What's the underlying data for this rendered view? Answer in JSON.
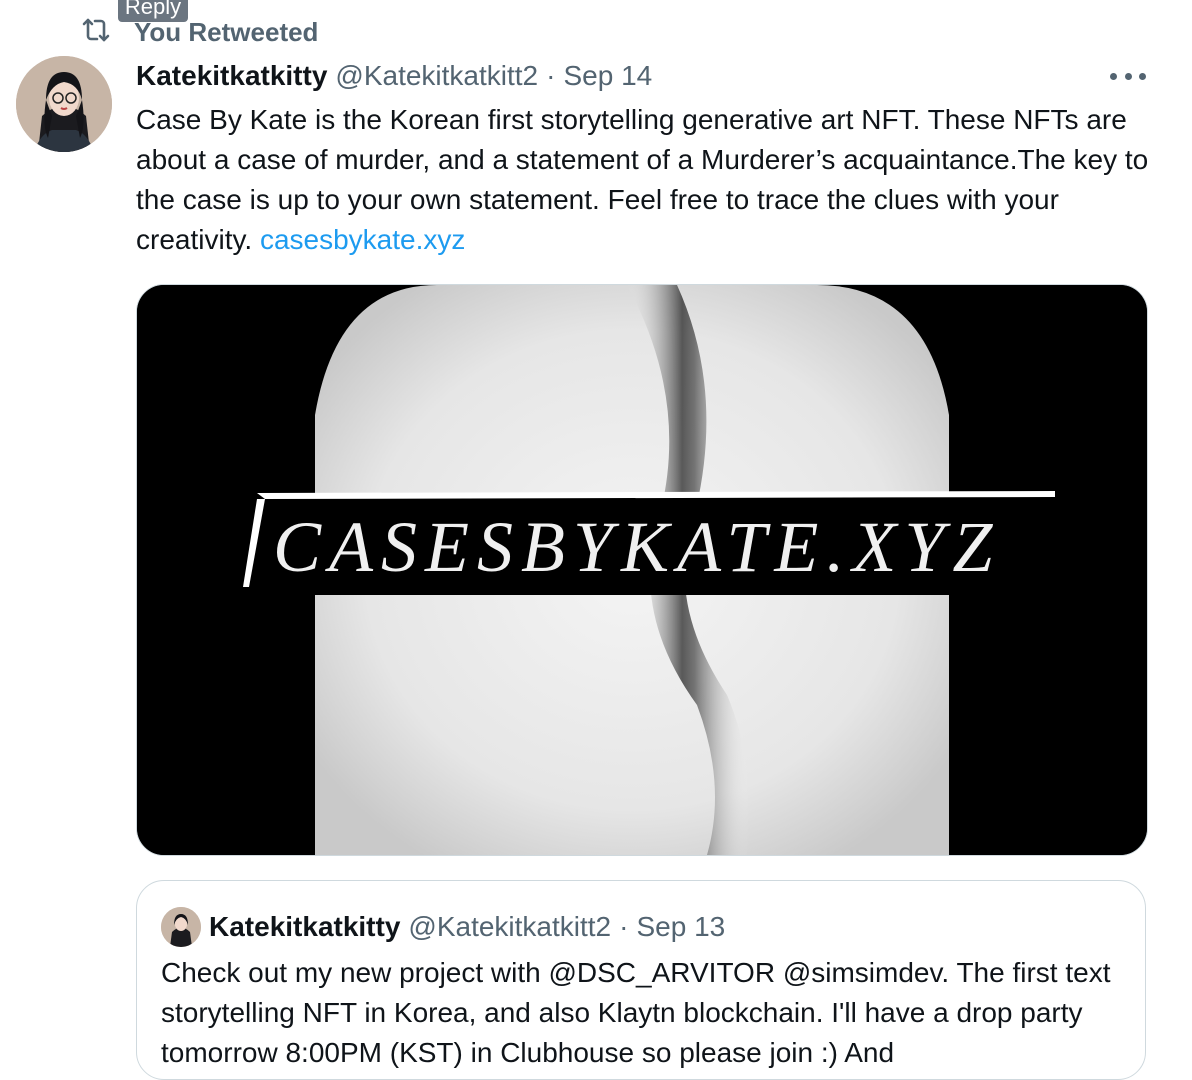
{
  "tooltip": {
    "label": "Reply"
  },
  "retweet": {
    "label": "You Retweeted",
    "icon": "retweet-icon"
  },
  "tweet": {
    "author_name": "Katekitkatkitty",
    "author_handle": "@Katekitkatkitt2",
    "separator": "·",
    "date": "Sep 14",
    "text": "Case By Kate is the Korean first storytelling generative art NFT. These NFTs are about a case of murder, and a statement of a Murderer’s acquaintance.The key to the case is up to your own statement. Feel free to trace the clues with your creativity. ",
    "link": "casesbykate.xyz",
    "more_icon": "more-icon",
    "media": {
      "banner_text": "CASESBYKATE.XYZ"
    }
  },
  "quote": {
    "author_name": "Katekitkatkitty",
    "author_handle": "@Katekitkatkitt2",
    "separator": "·",
    "date": "Sep 13",
    "text": "Check out my new project with @DSC_ARVITOR @simsimdev. The first text storytelling NFT in Korea, and also Klaytn blockchain. I'll have a drop party tomorrow 8:00PM (KST) in Clubhouse so please join :) And"
  }
}
